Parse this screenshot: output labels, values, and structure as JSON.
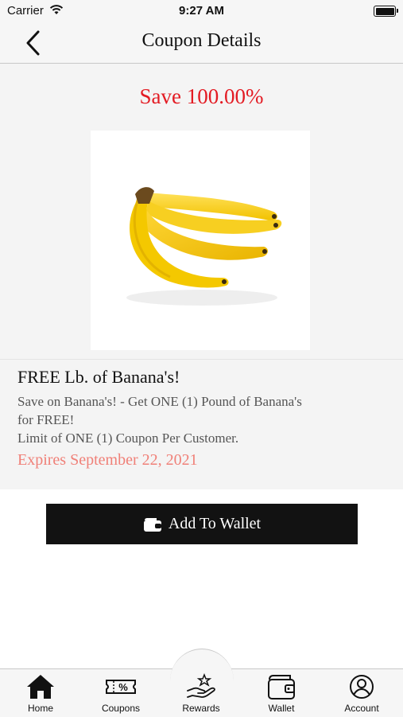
{
  "status_bar": {
    "carrier": "Carrier",
    "time": "9:27 AM"
  },
  "nav": {
    "title": "Coupon Details",
    "back_icon": "chevron-left-icon"
  },
  "coupon": {
    "save_text": "Save 100.00%",
    "image_icon": "banana-image",
    "title": "FREE Lb. of Banana's!",
    "description_lines": [
      "Save on Banana's! - Get ONE (1) Pound of Banana's",
      "for FREE!",
      "Limit of ONE (1) Coupon Per Customer."
    ],
    "expires": "Expires September 22, 2021"
  },
  "actions": {
    "add_to_wallet": "Add To Wallet",
    "wallet_icon": "wallet-icon"
  },
  "tab_bar": {
    "items": [
      {
        "label": "Home",
        "icon": "home-icon"
      },
      {
        "label": "Coupons",
        "icon": "coupon-ticket-icon"
      },
      {
        "label": "Rewards",
        "icon": "hand-star-icon"
      },
      {
        "label": "Wallet",
        "icon": "wallet-icon"
      },
      {
        "label": "Account",
        "icon": "account-icon"
      }
    ]
  },
  "colors": {
    "save_text": "#e31b23",
    "expires_text": "#f08078",
    "button_bg": "#121212"
  }
}
